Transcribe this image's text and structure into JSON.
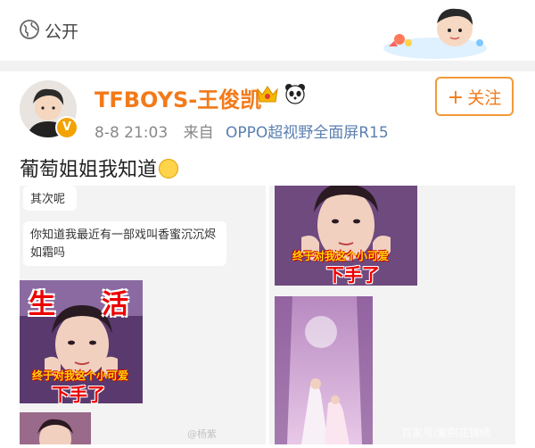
{
  "header": {
    "visibility_label": "公开",
    "visibility_icon": "globe-icon"
  },
  "post": {
    "author": "TFBOYS-王俊凯",
    "time": "8-8 21:03",
    "source_prefix": "来自",
    "source": "OPPO超视野全面屏R15",
    "follow_label": "关注",
    "text": "葡萄姐姐我知道",
    "verified_badge": "V",
    "accent_color": "#f27a1a"
  },
  "chat": {
    "message_1": "其次呢",
    "message_2": "你知道我最近有一部戏叫香蜜沉沉烬如霜吗"
  },
  "stickers": {
    "left_top_word_1": "生",
    "left_top_word_2": "活",
    "caption_line_1": "终于对我这个小可爱",
    "caption_line_2": "下手了",
    "right_caption_line_2": "下手了"
  },
  "watermark": {
    "left": "@杨紫",
    "right": "百家号/紫荆花锦绣"
  }
}
